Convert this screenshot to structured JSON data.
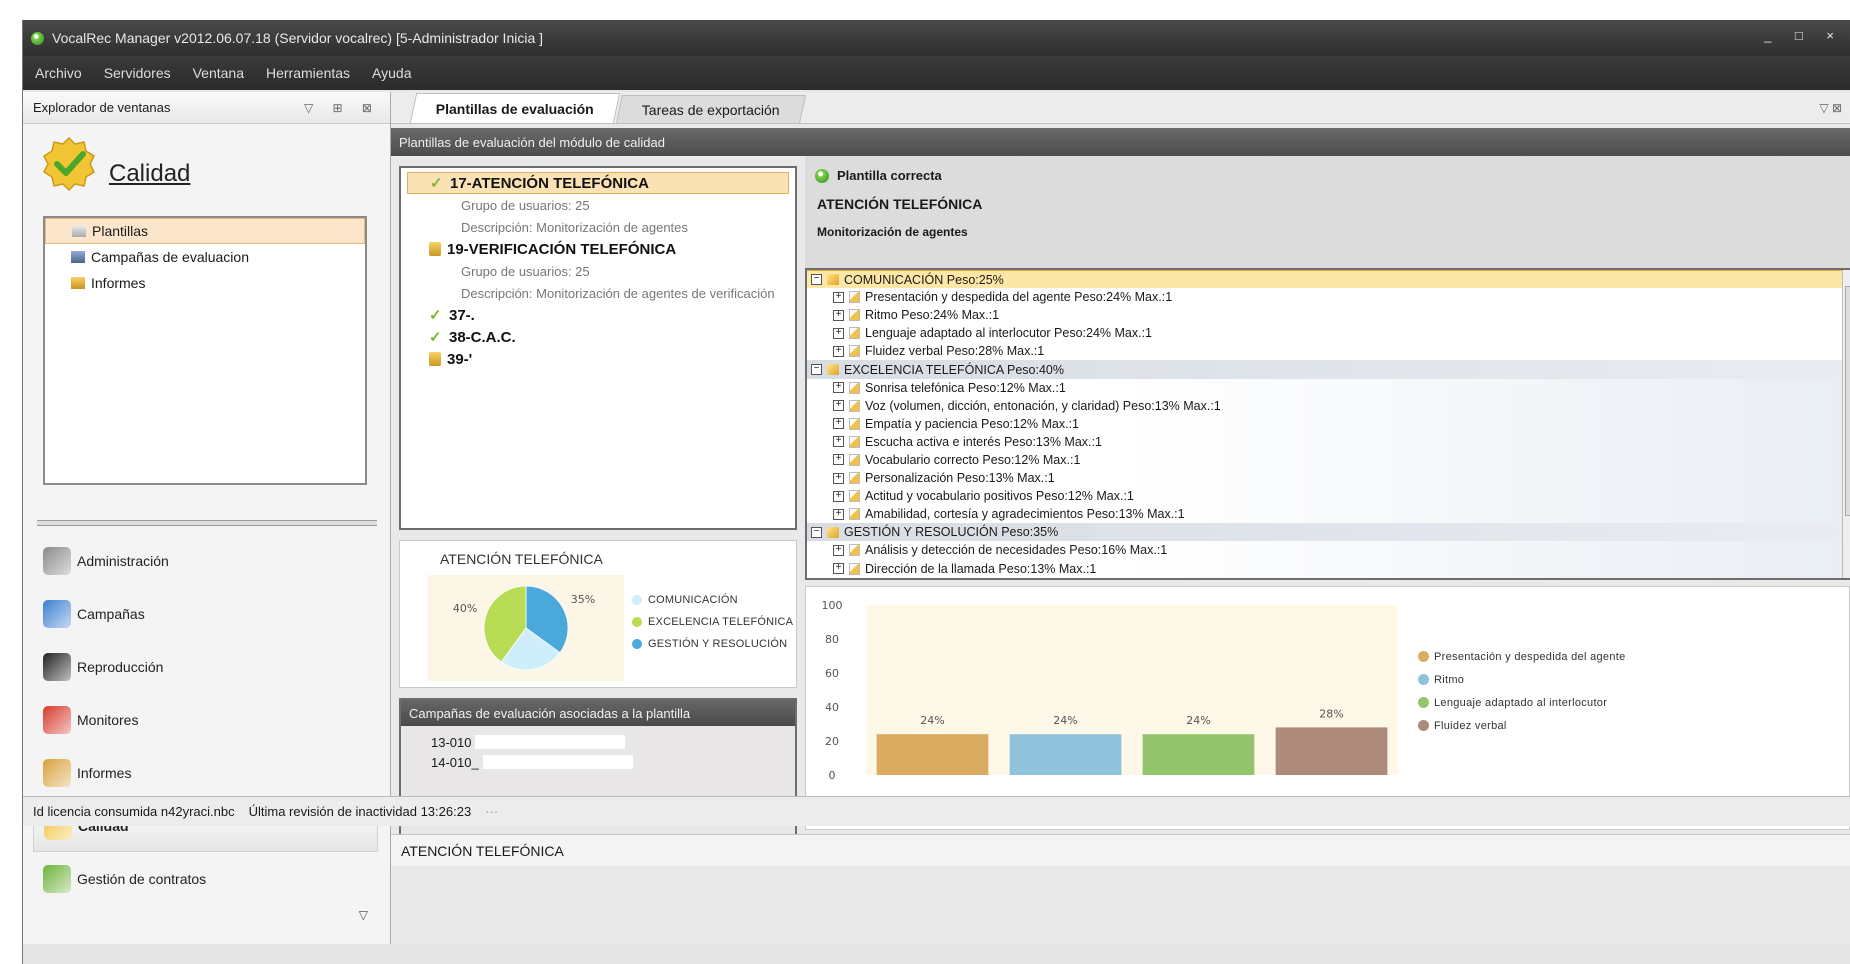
{
  "window": {
    "title": "VocalRec Manager v2012.06.07.18 (Servidor vocalrec)  [5-Administrador Inicia ]",
    "controls": "_ □ ×"
  },
  "menu": [
    "Archivo",
    "Servidores",
    "Ventana",
    "Herramientas",
    "Ayuda"
  ],
  "explorer": {
    "header": "Explorador de ventanas",
    "header_buttons": "▽ ⊞ ⊠",
    "section_title": "Calidad",
    "items": [
      {
        "label": "Plantillas",
        "icon": "templates-icon",
        "selected": true
      },
      {
        "label": "Campañas de evaluacion",
        "icon": "campaigns-icon",
        "selected": false
      },
      {
        "label": "Informes",
        "icon": "reports-icon",
        "selected": false
      }
    ],
    "modules": [
      {
        "label": "Administración",
        "icon": "administration-icon",
        "color": "#8a8a8a"
      },
      {
        "label": "Campañas",
        "icon": "campaigns-module-icon",
        "color": "#3b7fd0"
      },
      {
        "label": "Reproducción",
        "icon": "playback-icon",
        "color": "#222222"
      },
      {
        "label": "Monitores",
        "icon": "monitors-icon",
        "color": "#d63b2e"
      },
      {
        "label": "Informes",
        "icon": "reports-module-icon",
        "color": "#d9a13b"
      },
      {
        "label": "Calidad",
        "icon": "quality-icon",
        "color": "#f2c441",
        "selected": true
      },
      {
        "label": "Gestión de contratos",
        "icon": "contracts-icon",
        "color": "#6fb43c"
      }
    ],
    "chevron": "▽"
  },
  "tabs": [
    {
      "label": "Plantillas de evaluación",
      "active": true
    },
    {
      "label": "Tareas de exportación",
      "active": false
    }
  ],
  "tabs_pin": "▽ ⊠",
  "module_bar": "Plantillas de evaluación del módulo de calidad",
  "tree": [
    {
      "type": "tpl",
      "label": "17-ATENCIÓN TELEFÓNICA",
      "icon": "check",
      "selected": true
    },
    {
      "type": "sub",
      "label": "Grupo de usuarios: 25"
    },
    {
      "type": "sub",
      "label": "Descripción: Monitorización de agentes"
    },
    {
      "type": "tpl",
      "label": "19-VERIFICACIÓN TELEFÓNICA",
      "icon": "lock"
    },
    {
      "type": "sub",
      "label": "Grupo de usuarios: 25"
    },
    {
      "type": "sub",
      "label": "Descripción: Monitorización de agentes de verificación"
    },
    {
      "type": "tpl",
      "label": "37-.",
      "icon": "check"
    },
    {
      "type": "tpl",
      "label": "38-C.A.C.",
      "icon": "check"
    },
    {
      "type": "tpl",
      "label": "39-'",
      "icon": "lock"
    }
  ],
  "pie": {
    "title": "ATENCIÓN TELEFÓNICA"
  },
  "campaigns": {
    "header": "Campañas de evaluación asociadas a la plantilla",
    "rows": [
      "13-010",
      "14-010_"
    ]
  },
  "detail": {
    "status": "Plantilla correcta",
    "name": "ATENCIÓN TELEFÓNICA",
    "description": "Monitorización de agentes"
  },
  "criteria": [
    {
      "type": "cat",
      "label": "COMUNICACIÓN Peso:25%",
      "first": true
    },
    {
      "type": "item",
      "label": "Presentación y despedida del agente  Peso:24%  Max.:1",
      "hl": true
    },
    {
      "type": "item",
      "label": "Ritmo  Peso:24%  Max.:1",
      "hl": true
    },
    {
      "type": "item",
      "label": "Lenguaje adaptado al interlocutor  Peso:24%  Max.:1",
      "hl": true
    },
    {
      "type": "item",
      "label": "Fluidez verbal  Peso:28%  Max.:1",
      "hl": true
    },
    {
      "type": "cat",
      "label": "EXCELENCIA  TELEFÓNICA  Peso:40%"
    },
    {
      "type": "item",
      "label": "Sonrisa telefónica  Peso:12%  Max.:1"
    },
    {
      "type": "item",
      "label": "Voz (volumen, dicción, entonación, y claridad)  Peso:13%  Max.:1"
    },
    {
      "type": "item",
      "label": "Empatía y paciencia  Peso:12%  Max.:1"
    },
    {
      "type": "item",
      "label": "Escucha activa e interés  Peso:13%  Max.:1"
    },
    {
      "type": "item",
      "label": "Vocabulario correcto  Peso:12%  Max.:1"
    },
    {
      "type": "item",
      "label": "Personalización  Peso:13%  Max.:1"
    },
    {
      "type": "item",
      "label": "Actitud y vocabulario positivos  Peso:12%  Max.:1"
    },
    {
      "type": "item",
      "label": "Amabilidad, cortesía y agradecimientos  Peso:13%  Max.:1"
    },
    {
      "type": "cat",
      "label": "GESTIÓN Y RESOLUCIÓN  Peso:35%"
    },
    {
      "type": "item",
      "label": "Análisis y detección de necesidades  Peso:16%  Max.:1"
    },
    {
      "type": "item",
      "label": "Dirección de la llamada  Peso:13%  Max.:1"
    }
  ],
  "footer": "ATENCIÓN TELEFÓNICA",
  "status": [
    "Id licencia consumida n42yraci.nbc",
    "Última revisión de inactividad 13:26:23",
    "···"
  ],
  "chart_data": [
    {
      "type": "pie",
      "title": "ATENCIÓN TELEFÓNICA",
      "slices": [
        {
          "label": "COMUNICACIÓN",
          "value": 25,
          "text": "25%",
          "color": "#cfeefc"
        },
        {
          "label": "EXCELENCIA TELEFÓNICA",
          "value": 40,
          "text": "40%",
          "color": "#b9dc55"
        },
        {
          "label": "GESTIÓN Y RESOLUCIÓN",
          "value": 35,
          "text": "35%",
          "color": "#4aa8da"
        }
      ]
    },
    {
      "type": "bar",
      "categories": [
        "Presentación y despedida del agente",
        "Ritmo",
        "Lenguaje adaptado al interlocutor",
        "Fluidez verbal"
      ],
      "values": [
        24,
        24,
        24,
        28
      ],
      "labels": [
        "24%",
        "24%",
        "24%",
        "28%"
      ],
      "colors": [
        "#d9ac62",
        "#8fc3dc",
        "#92c56c",
        "#ad8a7c"
      ],
      "ylim": [
        0,
        100
      ],
      "yticks": [
        0,
        20,
        40,
        60,
        80,
        100
      ],
      "legend": "right"
    }
  ]
}
